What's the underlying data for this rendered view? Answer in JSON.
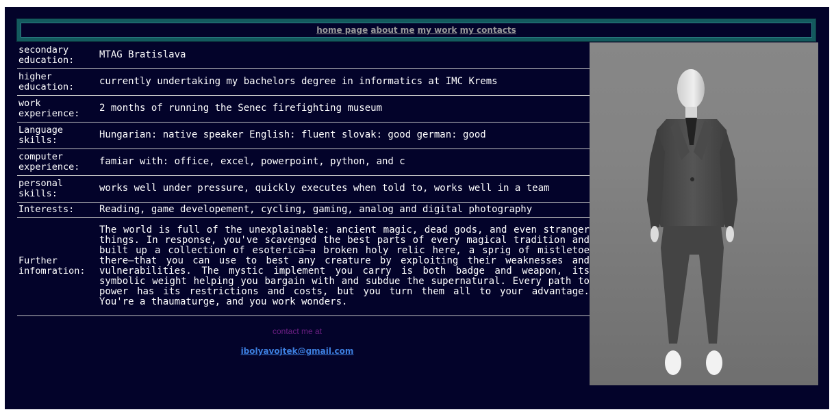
{
  "nav": {
    "links": [
      "home page",
      "about me",
      "my work",
      "my contacts"
    ]
  },
  "info": {
    "rows": [
      {
        "label": "secondary education:",
        "value": "MTAG Bratislava"
      },
      {
        "label": "higher education:",
        "value": "currently undertaking my bachelors degree in informatics at IMC Krems"
      },
      {
        "label": "work experience:",
        "value": "2 months of running the Senec firefighting museum"
      },
      {
        "label": "Language skills:",
        "value": "Hungarian: native speaker English: fluent slovak: good german: good"
      },
      {
        "label": "computer experience:",
        "value": "famiar with: office, excel, powerpoint, python, and c"
      },
      {
        "label": "personal skills:",
        "value": "works well under pressure, quickly executes when told to, works well in a team"
      },
      {
        "label": "Interests:",
        "value": "Reading, game developement, cycling, gaming, analog and digital photography"
      },
      {
        "label": "Further infomration:",
        "value": "The world is full of the unexplainable: ancient magic, dead gods, and even stranger things. In response, you've scavenged the best parts of every magical tradition and built up a collection of esoterica—a broken holy relic here, a sprig of mistletoe there—that you can use to best any creature by exploiting their weaknesses and vulnerabilities. The mystic implement you carry is both badge and weapon, its symbolic weight helping you bargain with and subdue the supernatural. Every path to power has its restrictions and costs, but you turn them all to your advantage. You're a thaumaturge, and you work wonders."
      }
    ]
  },
  "contact": {
    "label": "contact me at",
    "email": "ibolyavojtek@gmail.com"
  },
  "photo": {
    "subject": "mannequin-in-grey-suit"
  },
  "colors": {
    "page_background": "#03032a",
    "nav_border": "#135a5e",
    "link_color": "#9a9a9a",
    "contact_label": "#6b1f82",
    "email_link": "#3d7fe0"
  }
}
